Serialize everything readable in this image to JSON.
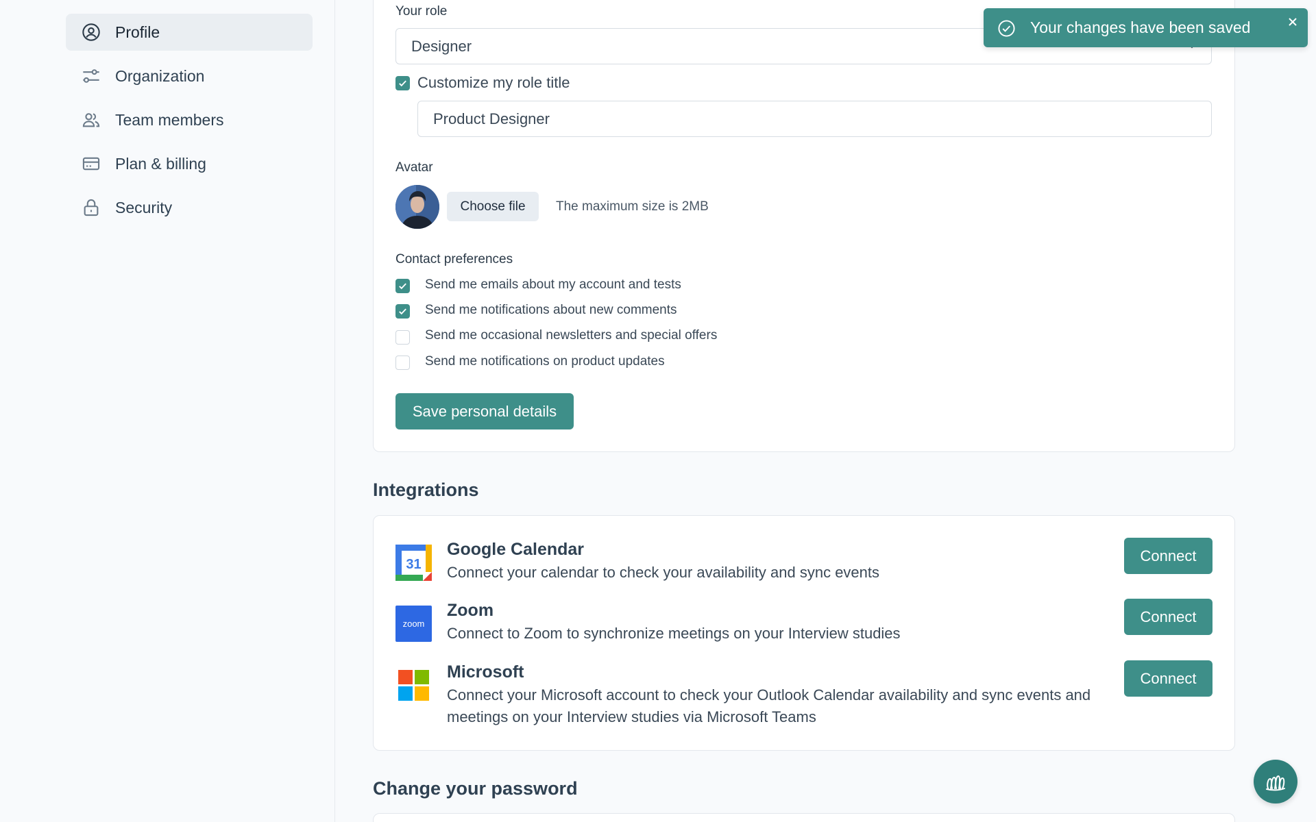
{
  "sidebar": {
    "items": [
      {
        "label": "Profile",
        "icon": "user-circle-icon",
        "active": true
      },
      {
        "label": "Organization",
        "icon": "sliders-icon"
      },
      {
        "label": "Team members",
        "icon": "users-icon"
      },
      {
        "label": "Plan & billing",
        "icon": "credit-card-icon"
      },
      {
        "label": "Security",
        "icon": "lock-icon"
      }
    ]
  },
  "profile": {
    "role_label": "Your role",
    "role_value": "Designer",
    "customize_label": "Customize my role title",
    "customize_checked": true,
    "role_title_value": "Product Designer",
    "avatar_label": "Avatar",
    "choose_file_label": "Choose file",
    "avatar_hint": "The maximum size is 2MB",
    "contact_label": "Contact preferences",
    "contact_options": [
      {
        "label": "Send me emails about my account and tests",
        "checked": true
      },
      {
        "label": "Send me notifications about new comments",
        "checked": true
      },
      {
        "label": "Send me occasional newsletters and special offers",
        "checked": false
      },
      {
        "label": "Send me notifications on product updates",
        "checked": false
      }
    ],
    "save_label": "Save personal details"
  },
  "integrations": {
    "title": "Integrations",
    "items": [
      {
        "name": "Google Calendar",
        "desc": "Connect your calendar to check your availability and sync events",
        "button": "Connect",
        "logo_text": "31"
      },
      {
        "name": "Zoom",
        "desc": "Connect to Zoom to synchronize meetings on your Interview studies",
        "button": "Connect",
        "logo_text": "zoom"
      },
      {
        "name": "Microsoft",
        "desc": "Connect your Microsoft account to check your Outlook Calendar availability and sync events and meetings on your Interview studies via Microsoft Teams",
        "button": "Connect"
      }
    ]
  },
  "password": {
    "title": "Change your password"
  },
  "toast": {
    "message": "Your changes have been saved"
  },
  "colors": {
    "accent": "#3e8f89",
    "background": "#f8fafc"
  }
}
